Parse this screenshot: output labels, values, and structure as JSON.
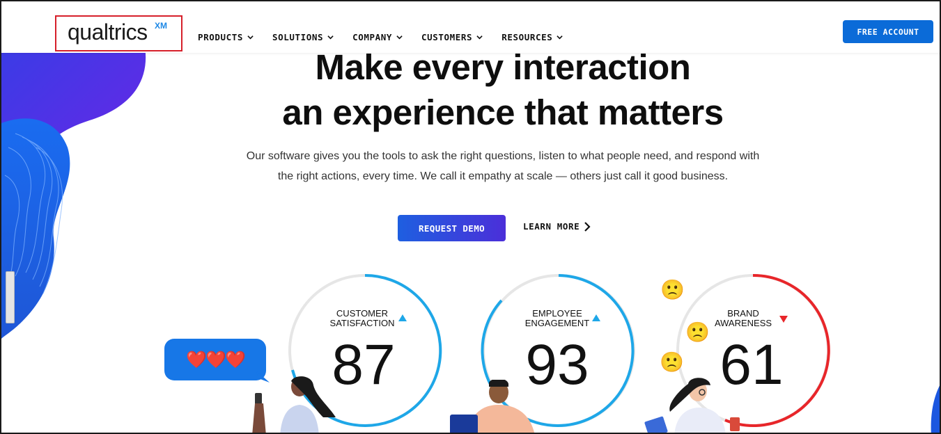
{
  "brand": {
    "logo_text": "qualtrics",
    "logo_badge": "XM"
  },
  "nav": {
    "items": [
      {
        "label": "PRODUCTS"
      },
      {
        "label": "SOLUTIONS"
      },
      {
        "label": "COMPANY"
      },
      {
        "label": "CUSTOMERS"
      },
      {
        "label": "RESOURCES"
      }
    ],
    "free_account_label": "FREE ACCOUNT"
  },
  "hero": {
    "title_line1": "Make every interaction",
    "title_line2": "an experience that matters",
    "subtitle_line1": "Our software gives you the tools to ask the right questions, listen to what people need, and respond with",
    "subtitle_line2": "the right actions, every time. We call it empathy at scale — others just call it good business.",
    "request_demo_label": "REQUEST DEMO",
    "learn_more_label": "LEARN MORE"
  },
  "metrics": [
    {
      "label_line1": "CUSTOMER",
      "label_line2": "SATISFACTION",
      "value": "87",
      "trend": "up",
      "color": "#1ea7e8"
    },
    {
      "label_line1": "EMPLOYEE",
      "label_line2": "ENGAGEMENT",
      "value": "93",
      "trend": "up",
      "color": "#1ea7e8"
    },
    {
      "label_line1": "BRAND",
      "label_line2": "AWARENESS",
      "value": "61",
      "trend": "down",
      "color": "#e8262a"
    }
  ],
  "bubble": {
    "text": "❤️❤️❤️"
  },
  "emojis": [
    "🙁",
    "🙁",
    "🙁"
  ],
  "colors": {
    "primary_blue": "#0b6bd8",
    "accent_purple": "#4b2fd9",
    "deco_blue": "#1c57e0"
  }
}
